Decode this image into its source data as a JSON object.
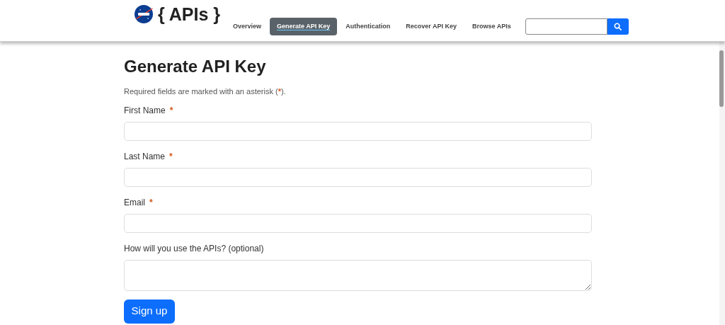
{
  "header": {
    "logo_text": "{ APIs }",
    "nav": [
      {
        "label": "Overview",
        "selected": false
      },
      {
        "label": "Generate API Key",
        "selected": true
      },
      {
        "label": "Authentication",
        "selected": false
      },
      {
        "label": "Recover API Key",
        "selected": false
      },
      {
        "label": "Browse APIs",
        "selected": false
      }
    ]
  },
  "form": {
    "title": "Generate API Key",
    "intro": {
      "before": "Required fields are marked with an asterisk (",
      "mark": "*",
      "after": ")."
    },
    "fields": [
      {
        "label": "First Name",
        "required_mark": "*",
        "kind": "input"
      },
      {
        "label": "Last Name",
        "required_mark": "*",
        "kind": "input"
      },
      {
        "label": "Email",
        "required_mark": "*",
        "kind": "input"
      },
      {
        "label": "How will you use the APIs? (optional)",
        "kind": "textarea"
      }
    ],
    "submit": "Sign up"
  }
}
